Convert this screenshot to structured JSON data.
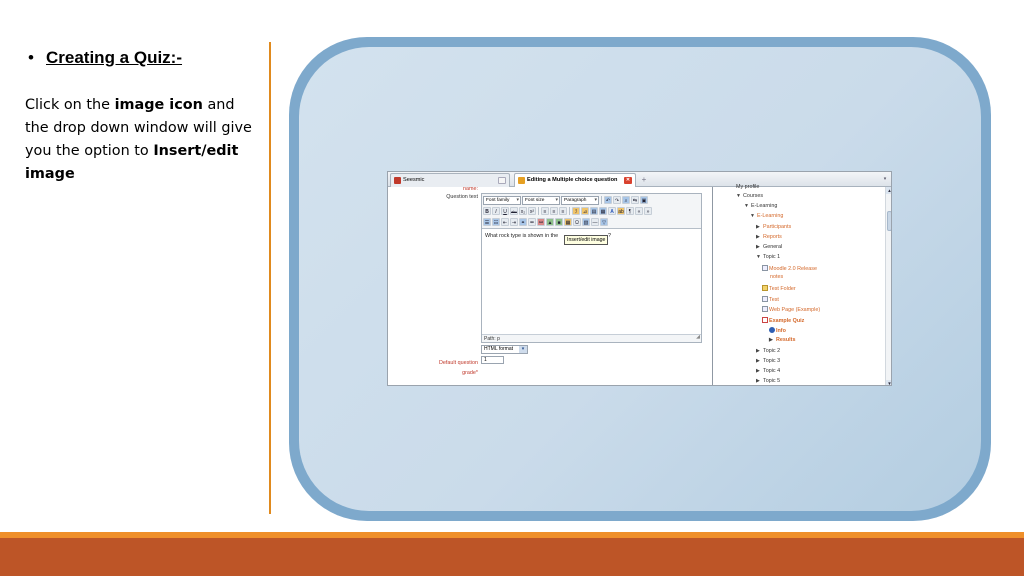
{
  "slide": {
    "bullet": "•",
    "heading": "Creating a Quiz:-",
    "body": {
      "part1": "Click on the ",
      "bold1": "image icon",
      "part2": " and the drop down window will give you the option to ",
      "bold2": "Insert/edit image"
    }
  },
  "colors": {
    "frame_border": "#7ea9cc",
    "frame_fill": "#cadbea",
    "divider": "#e08a1e",
    "footer_stripe": "#ef8f2a",
    "footer_bar": "#bd5527"
  },
  "browser": {
    "tabs": [
      {
        "label": "Seesmic",
        "icon": "seesmic-icon"
      },
      {
        "label": "Editing a Multiple choice question",
        "icon": "moodle-icon",
        "close": "✕"
      }
    ],
    "new_tab": "+",
    "scroll_arrow": "▾"
  },
  "form": {
    "name_label": "name:",
    "question_text_label": "Question text",
    "default_grade_label": "Default question grade*",
    "toolbar": {
      "font_family": "Font family",
      "font_size": "Font size",
      "paragraph": "Paragraph",
      "row1_buttons": [
        "↶",
        "↷",
        "⌕",
        "⇆",
        "▣"
      ],
      "row2_buttons": [
        "B",
        "I",
        "U",
        "abc",
        "x₂",
        "x²",
        "≡",
        "≡",
        "≡",
        "ℐ",
        "⊿",
        "▤",
        "▦",
        "A",
        "ab",
        "¶",
        "«",
        "»"
      ],
      "row3_buttons": [
        "☰",
        "☷",
        "⇤",
        "⇥",
        "⚭",
        "⚮",
        "⚯",
        "▲",
        "■",
        "▦",
        "Ω",
        "▧",
        "—",
        "▽"
      ]
    },
    "editor_text": "What rock type is shown in the",
    "editor_tail": "?",
    "tooltip": "Insert/edit image",
    "path": "Path: p",
    "format": "HTML format",
    "grade_value": "1"
  },
  "tree": {
    "items": [
      {
        "label": "My profile",
        "arrow": "",
        "indent": 22
      },
      {
        "label": "Courses",
        "arrow": "▼",
        "indent": 22
      },
      {
        "label": "E-Learning",
        "arrow": "▼",
        "indent": 30
      },
      {
        "label": "E-Learning",
        "arrow": "▼",
        "indent": 36,
        "link": true
      },
      {
        "label": "Participants",
        "arrow": "▶",
        "indent": 42,
        "link": true
      },
      {
        "label": "Reports",
        "arrow": "▶",
        "indent": 42,
        "link": true
      },
      {
        "label": "General",
        "arrow": "▶",
        "indent": 42
      },
      {
        "label": "Topic 1",
        "arrow": "▼",
        "indent": 42
      },
      {
        "label": "Moodle 2.0 Release",
        "icon": "page",
        "indent": 48,
        "link": true
      },
      {
        "label": "notes",
        "indent": 57,
        "link": true
      },
      {
        "label": "Test Folder",
        "icon": "folder",
        "indent": 48,
        "link": true
      },
      {
        "label": "Test",
        "icon": "page",
        "indent": 48,
        "link": true
      },
      {
        "label": "Web Page (Example)",
        "icon": "page",
        "indent": 48,
        "link": true
      },
      {
        "label": "Example Quiz",
        "icon": "quiz",
        "indent": 48,
        "link": true,
        "bold": true
      },
      {
        "label": "Info",
        "icon": "info",
        "indent": 55,
        "link": true,
        "bold": true
      },
      {
        "label": "Results",
        "arrow": "▶",
        "indent": 55,
        "link": true,
        "bold": true
      },
      {
        "label": "Topic 2",
        "arrow": "▶",
        "indent": 42
      },
      {
        "label": "Topic 3",
        "arrow": "▶",
        "indent": 42
      },
      {
        "label": "Topic 4",
        "arrow": "▶",
        "indent": 42
      },
      {
        "label": "Topic 5",
        "arrow": "▶",
        "indent": 42
      }
    ],
    "scroll_up": "▲",
    "scroll_down": "▼"
  }
}
